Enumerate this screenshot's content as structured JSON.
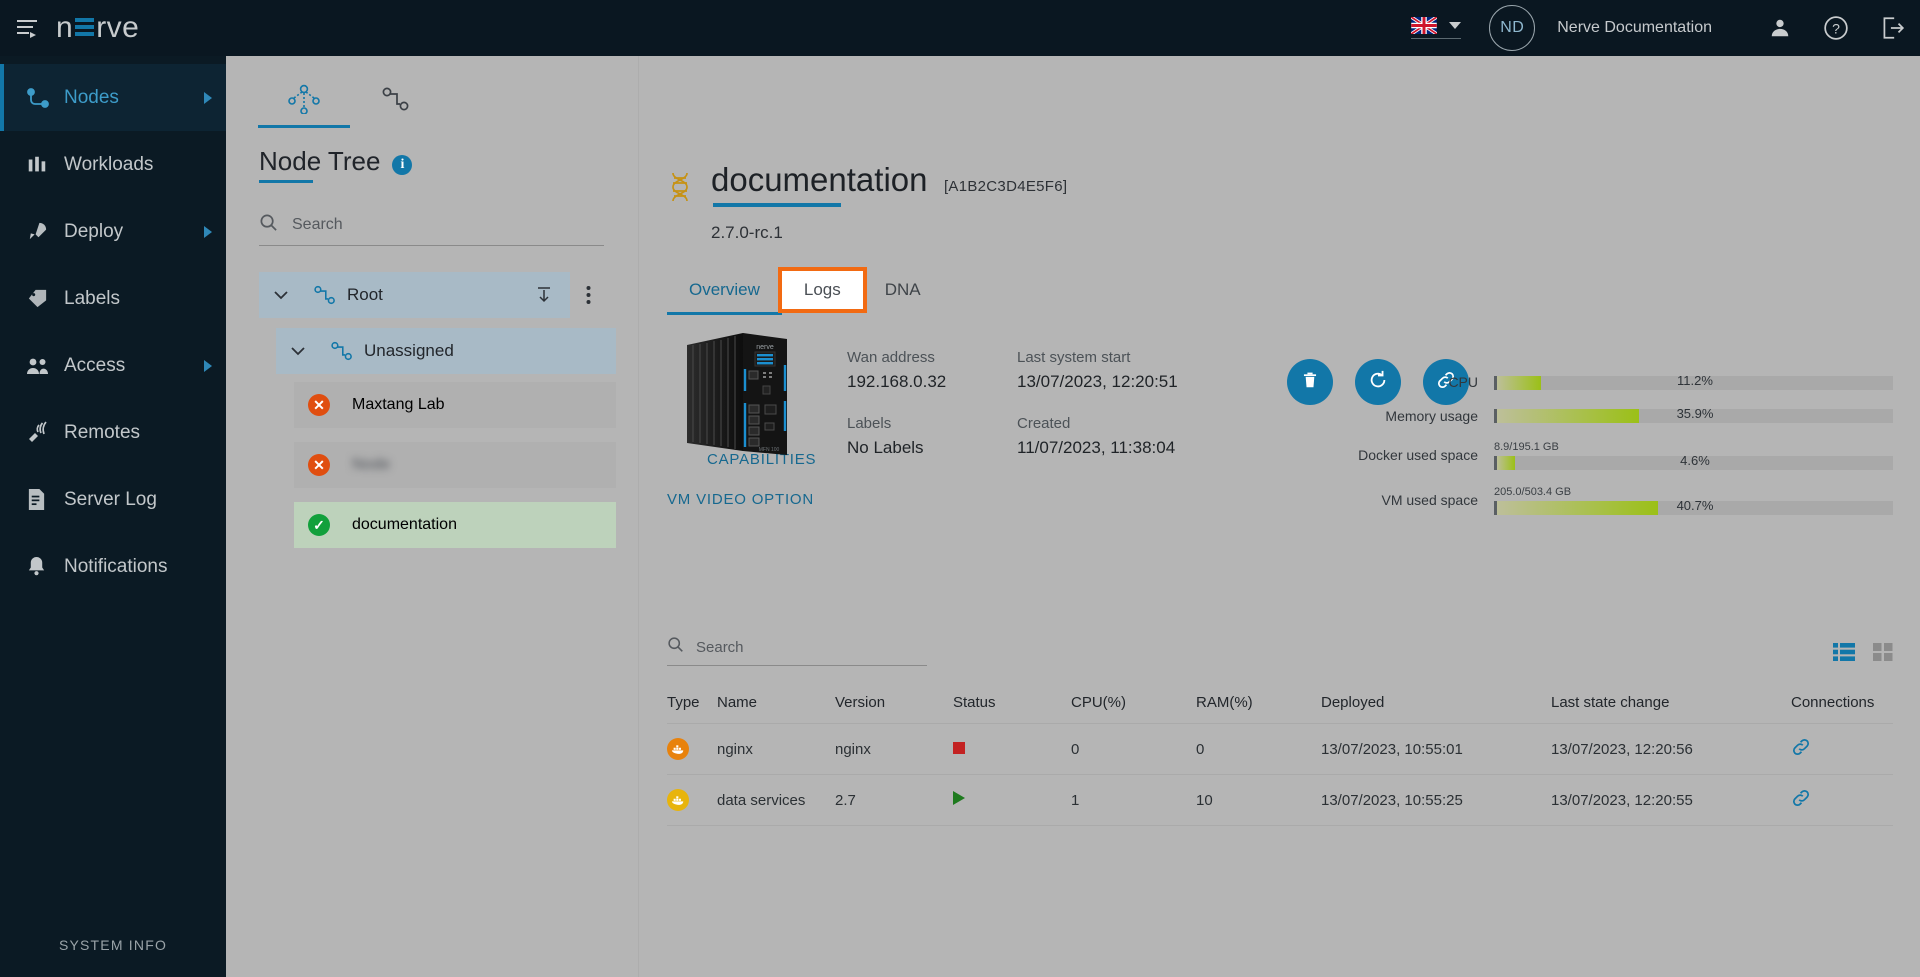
{
  "topbar": {
    "logo_text": "nerve",
    "menu_icon": "hamburger-menu-icon",
    "language_flag": "uk-flag-icon",
    "avatar_initials": "ND",
    "org_name": "Nerve Documentation",
    "user_icon": "user-icon",
    "help_icon": "help-question-icon",
    "logout_icon": "logout-icon"
  },
  "sidebar": {
    "items": [
      {
        "label": "Nodes",
        "icon": "nodes-icon",
        "active": true,
        "has_arrow": true
      },
      {
        "label": "Workloads",
        "icon": "workloads-icon",
        "active": false,
        "has_arrow": false
      },
      {
        "label": "Deploy",
        "icon": "deploy-rocket-icon",
        "active": false,
        "has_arrow": true
      },
      {
        "label": "Labels",
        "icon": "labels-tag-icon",
        "active": false,
        "has_arrow": false
      },
      {
        "label": "Access",
        "icon": "access-users-icon",
        "active": false,
        "has_arrow": true
      },
      {
        "label": "Remotes",
        "icon": "remotes-icon",
        "active": false,
        "has_arrow": false
      },
      {
        "label": "Server Log",
        "icon": "server-log-icon",
        "active": false,
        "has_arrow": false
      },
      {
        "label": "Notifications",
        "icon": "bell-icon",
        "active": false,
        "has_arrow": false
      }
    ],
    "system_info": "SYSTEM INFO"
  },
  "tree_panel": {
    "tabs": [
      {
        "name": "node-tree-tab",
        "icon": "tree-hierarchy-icon",
        "active": true
      },
      {
        "name": "node-list-tab",
        "icon": "node-link-icon",
        "active": false
      }
    ],
    "title": "Node Tree",
    "info_icon": "info-icon",
    "search": {
      "placeholder": "Search",
      "value": ""
    },
    "root": {
      "label": "Root",
      "icon": "node-link-icon",
      "download_icon": "download-icon",
      "menu_icon": "kebab-menu-icon"
    },
    "unassigned": {
      "label": "Unassigned",
      "icon": "node-link-icon"
    },
    "nodes": [
      {
        "label": "Maxtang Lab",
        "status": "error",
        "blurred": false,
        "selected": false
      },
      {
        "label": "redacted",
        "status": "error",
        "blurred": true,
        "selected": false
      },
      {
        "label": "documentation",
        "status": "online",
        "blurred": false,
        "selected": true
      }
    ]
  },
  "node_detail": {
    "dna_icon": "dna-helix-icon",
    "title": "documentation",
    "serial": "[A1B2C3D4E5F6]",
    "version": "2.7.0-rc.1",
    "tabs": [
      {
        "label": "Overview",
        "state": "active"
      },
      {
        "label": "Logs",
        "state": "focused"
      },
      {
        "label": "DNA",
        "state": "normal"
      }
    ],
    "device_image_alt": "nerve-industrial-gateway-device",
    "info": [
      {
        "label": "Wan address",
        "value": "192.168.0.32"
      },
      {
        "label": "Last system start",
        "value": "13/07/2023, 12:20:51"
      },
      {
        "label": "Labels",
        "value": "No Labels"
      },
      {
        "label": "Created",
        "value": "11/07/2023, 11:38:04"
      }
    ],
    "actions": [
      {
        "name": "delete-node-button",
        "icon": "trash-icon"
      },
      {
        "name": "reboot-node-button",
        "icon": "reboot-icon"
      },
      {
        "name": "connect-node-button",
        "icon": "link-chain-icon"
      }
    ],
    "capabilities_link": "CAPABILITIES",
    "vm_video_link": "VM VIDEO OPTION"
  },
  "resources": [
    {
      "label": "CPU",
      "percent": "11.2%",
      "fill": 11.2,
      "sub": ""
    },
    {
      "label": "Memory usage",
      "percent": "35.9%",
      "fill": 35.9,
      "sub": ""
    },
    {
      "label": "Docker used space",
      "percent": "4.6%",
      "fill": 4.6,
      "sub": "8.9/195.1 GB"
    },
    {
      "label": "VM used space",
      "percent": "40.7%",
      "fill": 40.7,
      "sub": "205.0/503.4 GB"
    }
  ],
  "workloads": {
    "search": {
      "placeholder": "Search",
      "value": ""
    },
    "view_list_icon": "list-view-icon",
    "view_grid_icon": "grid-view-icon",
    "columns": [
      "Type",
      "Name",
      "Version",
      "Status",
      "CPU(%)",
      "RAM(%)",
      "Deployed",
      "Last state change",
      "Connections"
    ],
    "rows": [
      {
        "type_icon": "docker-icon",
        "type_color": "#e8820c",
        "name": "nginx",
        "version": "nginx",
        "status": "stopped",
        "cpu": "0",
        "ram": "0",
        "deployed": "13/07/2023, 10:55:01",
        "last_state_change": "13/07/2023, 12:20:56",
        "connection_icon": "link-chain-icon"
      },
      {
        "type_icon": "docker-icon",
        "type_color": "#e8b40c",
        "name": "data services",
        "version": "2.7",
        "status": "running",
        "cpu": "1",
        "ram": "10",
        "deployed": "13/07/2023, 10:55:25",
        "last_state_change": "13/07/2023, 12:20:55",
        "connection_icon": "link-chain-icon"
      }
    ]
  },
  "colors": {
    "brand_blue": "#1277a8",
    "dark_bg": "#0a1721",
    "page_bg": "#b5b5b5",
    "focus_orange": "#f26a12",
    "status_error": "#e04e10",
    "status_ok": "#12a03c",
    "bar_green": "#9bc017"
  }
}
